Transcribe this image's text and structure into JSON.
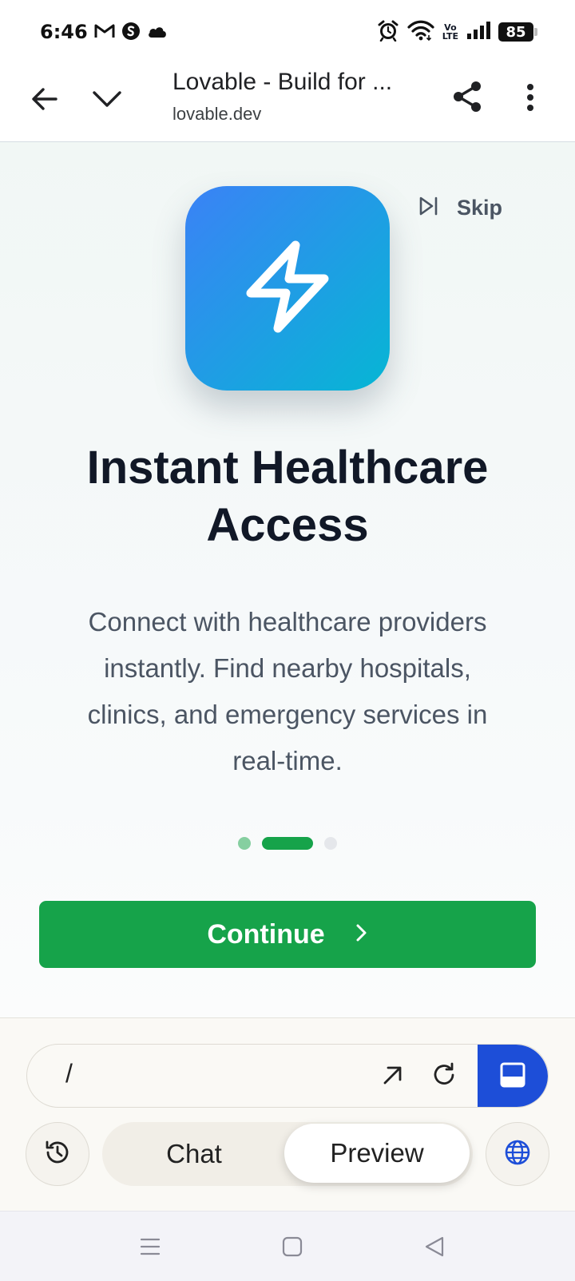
{
  "status_bar": {
    "time": "6:46",
    "battery": "85",
    "volte": [
      "Vo",
      "LTE"
    ],
    "left_icons": [
      "gmail-icon",
      "shazam-icon",
      "cloud-icon"
    ],
    "right_icons": [
      "alarm-icon",
      "wifi-icon",
      "volte-icon",
      "signal-icon",
      "battery-icon"
    ]
  },
  "browser": {
    "title": "Lovable - Build for ...",
    "url": "lovable.dev",
    "icons": [
      "back-arrow-icon",
      "chevron-down-icon",
      "share-icon",
      "more-vert-icon"
    ]
  },
  "onboarding": {
    "skip_label": "Skip",
    "headline": "Instant Healthcare Access",
    "description": "Connect with healthcare providers instantly. Find nearby hospitals, clinics, and emergency services in real-time.",
    "continue_label": "Continue",
    "page_count": 3,
    "active_page": 2,
    "colors": {
      "accent": "#16a34a",
      "icon_gradient_start": "#3b82f6",
      "icon_gradient_end": "#06b6d4",
      "dot_done": "#86cfa0",
      "dot_active": "#16a34a",
      "dot_inactive": "#e5e7eb"
    }
  },
  "editor_panel": {
    "path": "/",
    "tabs": {
      "chat": "Chat",
      "preview": "Preview"
    },
    "active_tab": "Preview",
    "toggle_color": "#1d4ed8",
    "icons": [
      "history-icon",
      "open-external-icon",
      "reload-icon",
      "panel-toggle-icon",
      "globe-icon"
    ]
  },
  "system_nav": {
    "icons": [
      "menu-icon",
      "home-square-icon",
      "back-triangle-icon"
    ]
  }
}
